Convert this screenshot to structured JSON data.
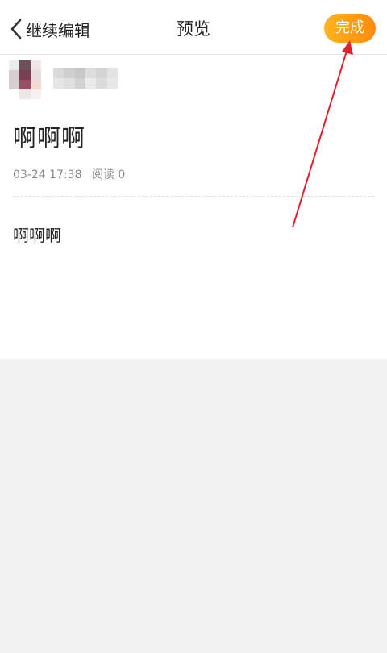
{
  "header": {
    "back_label": "继续编辑",
    "title": "预览",
    "done_label": "完成"
  },
  "post": {
    "title": "啊啊啊",
    "date": "03-24 17:38",
    "reads": "阅读 0",
    "body": "啊啊啊"
  },
  "colors": {
    "accent": "#ff9c12",
    "annotation": "#e0202a"
  }
}
